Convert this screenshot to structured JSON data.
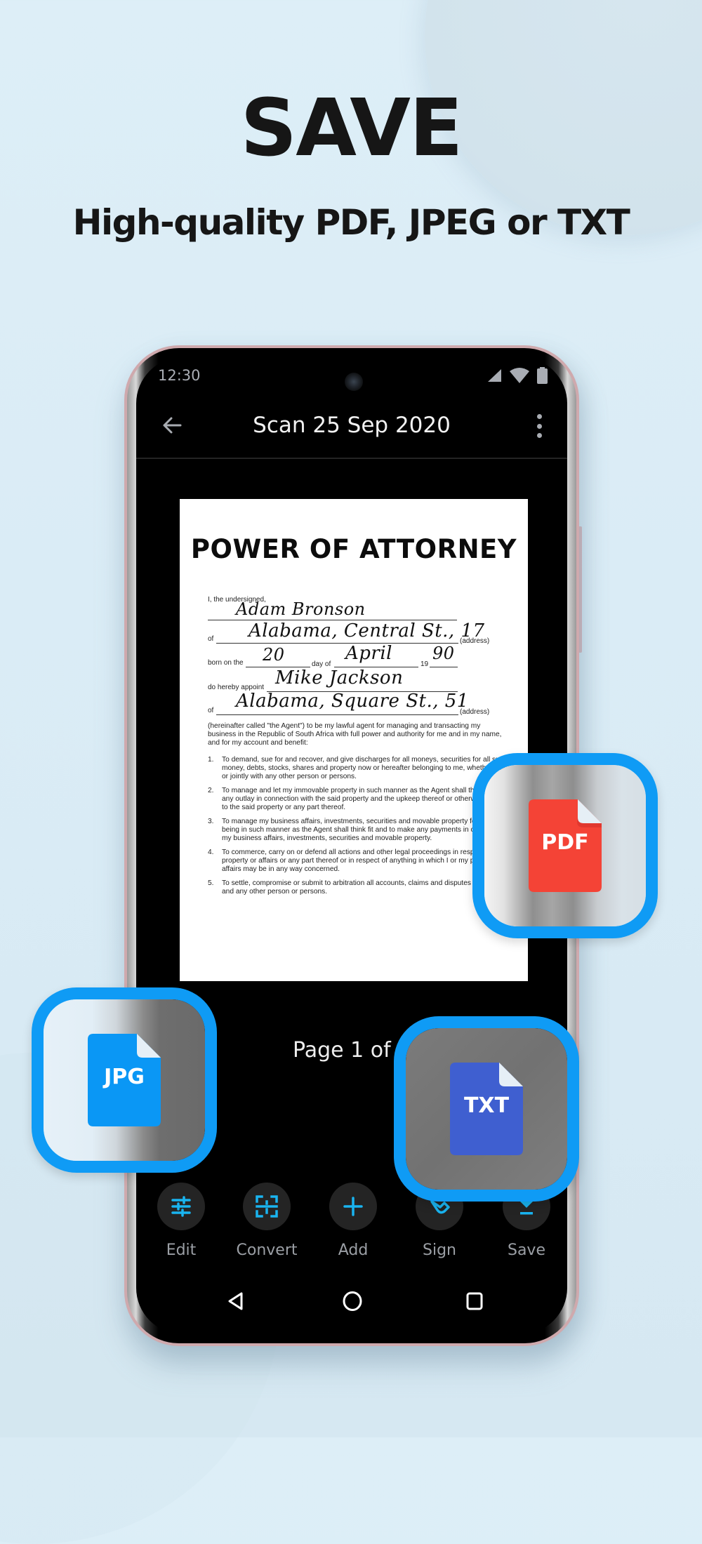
{
  "headline": "SAVE",
  "subheadline": "High-quality PDF, JPEG or TXT",
  "phone": {
    "status_bar": {
      "time": "12:30",
      "icons": [
        "signal-icon",
        "wifi-icon",
        "battery-icon"
      ]
    },
    "toolbar": {
      "title": "Scan 25 Sep 2020",
      "back_icon": "arrow-left-icon",
      "menu_icon": "more-vertical-icon"
    },
    "document": {
      "title": "POWER OF ATTORNEY",
      "intro_label": "I, the undersigned,",
      "principal_name": "Adam Bronson",
      "of_label": "of",
      "address_label": "(address)",
      "principal_address": "Alabama, Central St., 17",
      "born_label": "born on the",
      "born_day": "20",
      "day_of_label": "day of",
      "born_month": "April",
      "year_prefix": "19",
      "born_year": "90",
      "appoint_label": "do hereby appoint",
      "agent_name": "Mike Jackson",
      "agent_address": "Alabama, Square St., 51",
      "paragraph": "(hereinafter called \"the Agent\") to be my lawful agent for managing and transacting my business in the Republic of South Africa with full power and authority for me and in my name, and for my account and benefit:",
      "items": [
        {
          "num": "1.",
          "text": "To demand, sue for and recover, and give discharges for all moneys, securities for all sums of money, debts, stocks, shares and property now or hereafter belonging to me, whether solely or jointly with any other person or persons."
        },
        {
          "num": "2.",
          "text": "To manage and let my immovable property in such manner as the Agent shall think fit, make any outlay in connection with the said property and the upkeep thereof or otherwise in relation to the said property or any part thereof."
        },
        {
          "num": "3.",
          "text": "To manage my business affairs, investments, securities and movable property for the time being in such manner as the Agent shall think fit and to make any payments in connection with my business affairs, investments, securities and movable property."
        },
        {
          "num": "4.",
          "text": "To commerce, carry on or defend all actions and other legal proceedings in respect of my property or affairs or any part thereof or in respect of anything in which I or my property or affairs may be in any way concerned."
        },
        {
          "num": "5.",
          "text": "To settle, compromise or submit to arbitration all accounts, claims and disputes between me and any other person or persons."
        }
      ]
    },
    "page_indicator": "Page 1 of",
    "actions": [
      {
        "label": "Edit",
        "icon": "sliders-icon"
      },
      {
        "label": "Convert",
        "icon": "scan-text-icon"
      },
      {
        "label": "Add",
        "icon": "plus-icon"
      },
      {
        "label": "Sign",
        "icon": "signature-icon"
      },
      {
        "label": "Save",
        "icon": "download-icon"
      }
    ],
    "nav": [
      "nav-back-icon",
      "nav-home-icon",
      "nav-recents-icon"
    ]
  },
  "badges": {
    "pdf": {
      "label": "PDF",
      "color": "#f44336"
    },
    "jpg": {
      "label": "JPG",
      "color": "#0a97f5"
    },
    "txt": {
      "label": "TXT",
      "color": "#3f5fd0"
    }
  },
  "colors": {
    "accent": "#0f9bf5",
    "action_icon": "#19b4f0",
    "background": "#ddeef7"
  }
}
